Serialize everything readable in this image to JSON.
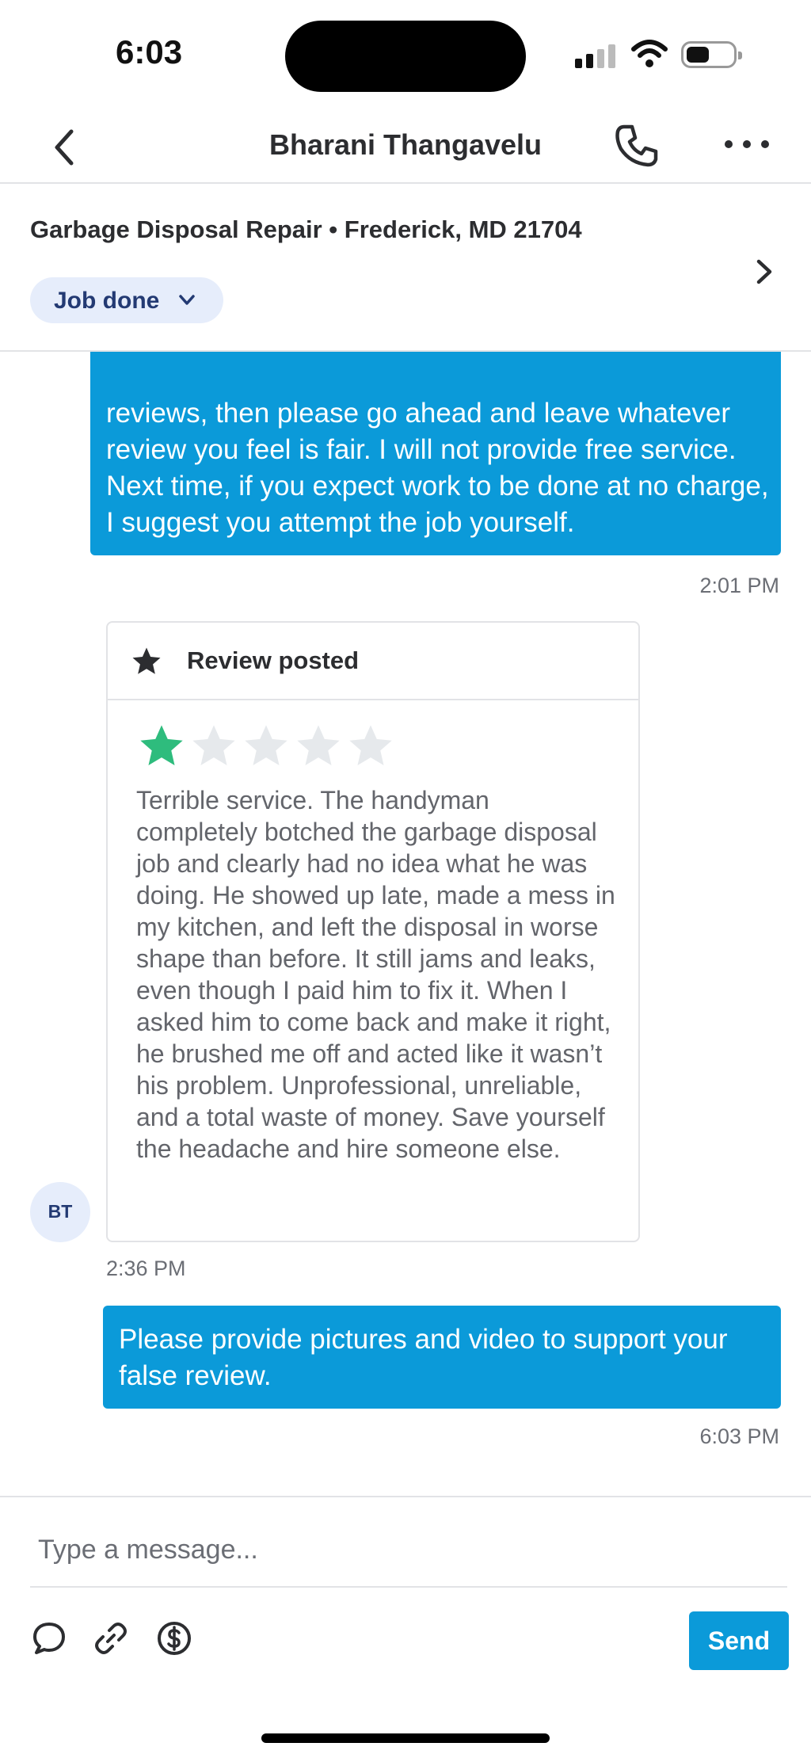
{
  "status_bar": {
    "time": "6:03"
  },
  "header": {
    "contact_name": "Bharani Thangavelu"
  },
  "job": {
    "title": "Garbage Disposal Repair • Frederick, MD 21704",
    "status": "Job done"
  },
  "messages": {
    "outgoing_1": {
      "text": "reviews, then please go ahead and leave whatever review you feel is fair. I will not provide free service. Next time, if you expect work to be done at no charge, I suggest you attempt the job yourself.",
      "time": "2:01 PM"
    },
    "review": {
      "header": "Review posted",
      "rating": 1,
      "max_rating": 5,
      "text": "Terrible service. The handyman completely botched the garbage disposal job and clearly had no idea what he was doing. He showed up late, made a mess in my kitchen, and left the disposal in worse shape than before. It still jams and leaks, even though I paid him to fix it. When I asked him to come back and make it right, he brushed me off and acted like it wasn’t his problem. Unprofessional, unreliable, and a total waste of money. Save yourself the headache and hire someone else.",
      "avatar_initials": "BT",
      "time": "2:36 PM"
    },
    "outgoing_2": {
      "text": "Please provide pictures and video to support your false review.",
      "time": "6:03 PM"
    }
  },
  "composer": {
    "placeholder": "Type a message...",
    "send_label": "Send",
    "tools": [
      "chat-bubble-icon",
      "link-icon",
      "dollar-icon"
    ]
  },
  "colors": {
    "accent": "#0b9ad9",
    "star_filled": "#2ebc7d",
    "star_empty": "#e6e9ec",
    "pill_bg": "#e6edfb",
    "pill_text": "#233a73"
  }
}
